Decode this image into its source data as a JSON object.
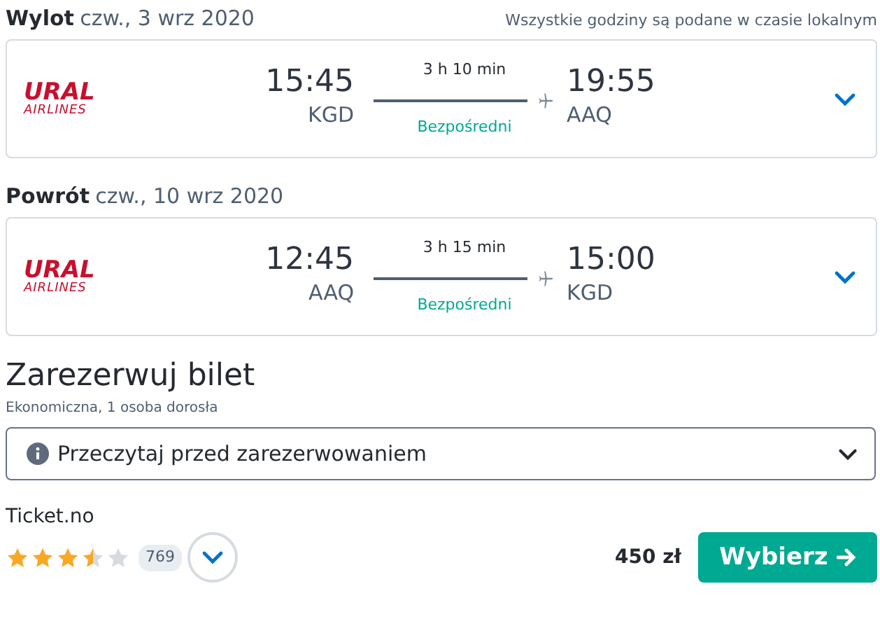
{
  "legs": [
    {
      "label": "Wylot",
      "date": "czw., 3 wrz 2020",
      "note": "Wszystkie godziny są podane w czasie lokalnym",
      "airline": {
        "name": "URAL",
        "subname": "AIRLINES"
      },
      "depart_time": "15:45",
      "depart_airport": "KGD",
      "duration": "3 h 10 min",
      "stops": "Bezpośredni",
      "arrive_time": "19:55",
      "arrive_airport": "AAQ"
    },
    {
      "label": "Powrót",
      "date": "czw., 10 wrz 2020",
      "airline": {
        "name": "URAL",
        "subname": "AIRLINES"
      },
      "depart_time": "12:45",
      "depart_airport": "AAQ",
      "duration": "3 h 15 min",
      "stops": "Bezpośredni",
      "arrive_time": "15:00",
      "arrive_airport": "KGD"
    }
  ],
  "booking": {
    "title": "Zarezerwuj bilet",
    "subtitle": "Ekonomiczna, 1 osoba dorosła",
    "info": "Przeczytaj przed zarezerwowaniem",
    "provider": "Ticket.no",
    "stars": 3.5,
    "reviews": "769",
    "price": "450 zł",
    "button": "Wybierz"
  }
}
